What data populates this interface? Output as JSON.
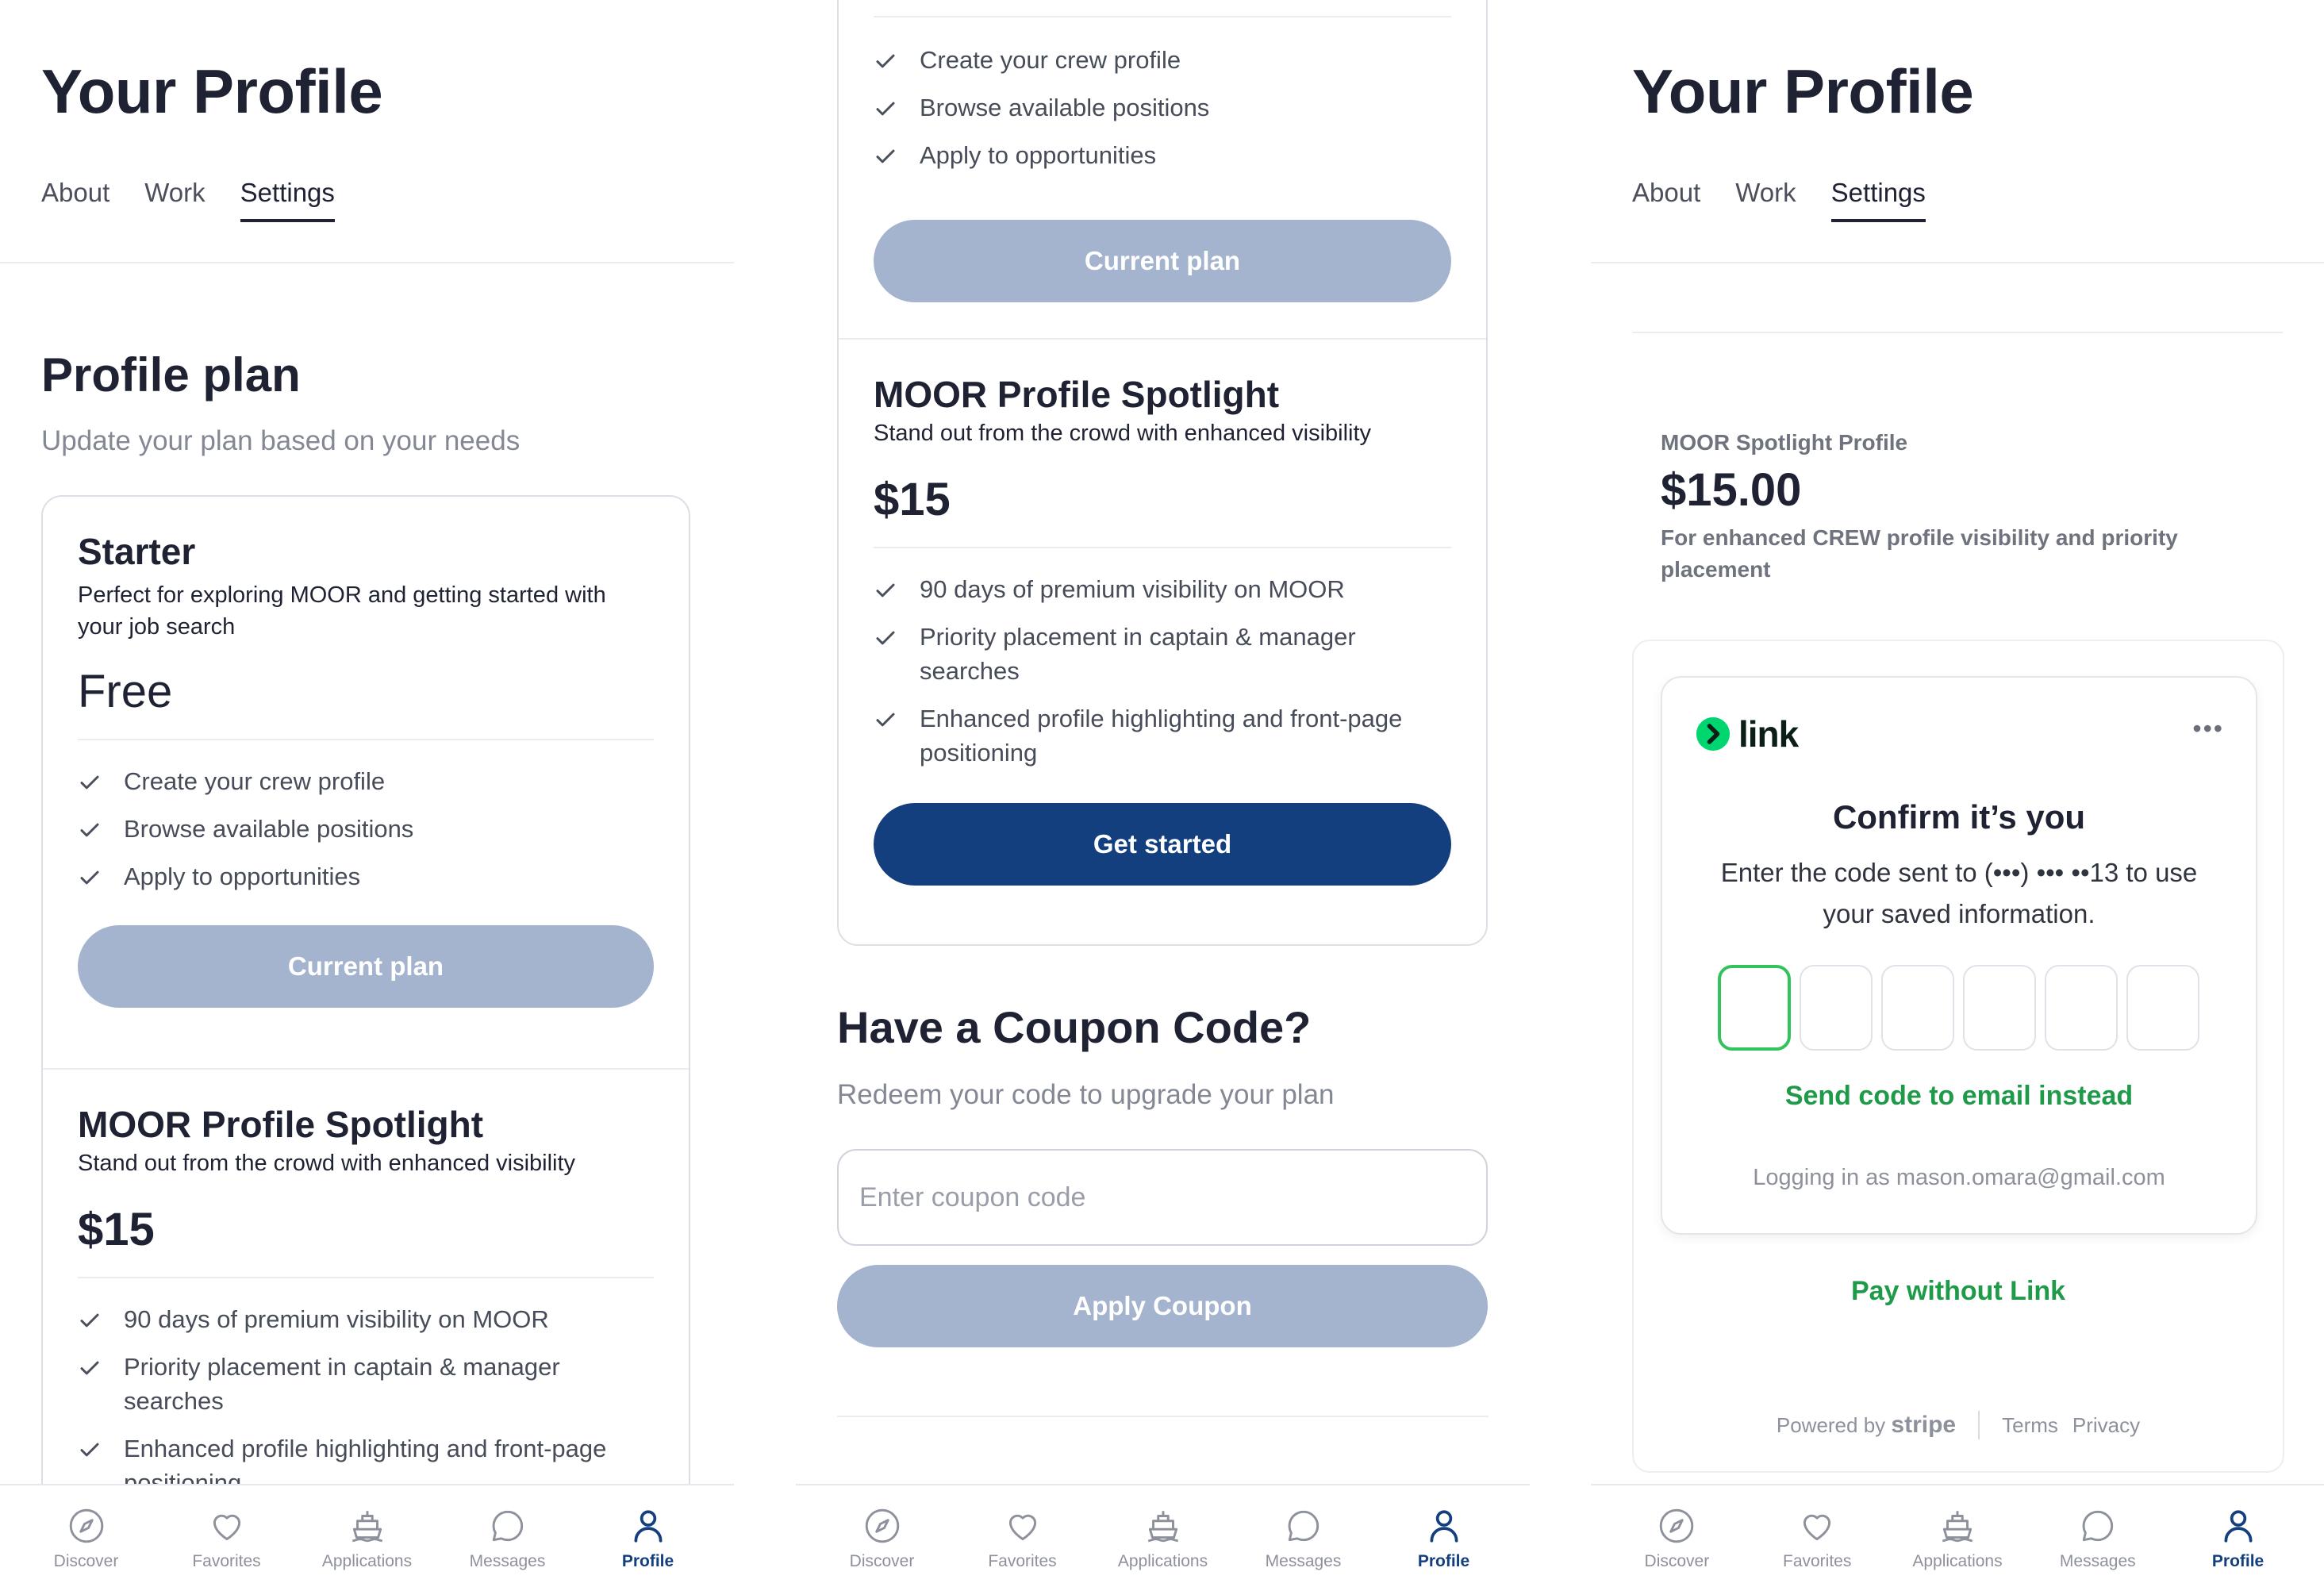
{
  "colors": {
    "primary": "#133f7f",
    "disabled_button": "#a4b4cf",
    "link_green": "#1f9a49",
    "link_green_focus": "#33c35d"
  },
  "profile": {
    "title": "Your Profile",
    "tabs": [
      "About",
      "Work",
      "Settings"
    ],
    "active_tab": "Settings"
  },
  "plan_section": {
    "title": "Profile plan",
    "subtitle": "Update your plan based on your needs"
  },
  "plans": [
    {
      "name": "Starter",
      "description": "Perfect for exploring MOOR and getting started with your job search",
      "price": "Free",
      "features": [
        "Create your crew profile",
        "Browse available positions",
        "Apply to opportunities"
      ],
      "button": "Current plan"
    },
    {
      "name": "MOOR Profile Spotlight",
      "description": "Stand out from the crowd with enhanced visibility",
      "price": "$15",
      "features": [
        "90 days of premium visibility on MOOR",
        "Priority placement in captain & manager searches",
        "Enhanced profile highlighting and front-page positioning"
      ],
      "button": "Get started"
    }
  ],
  "coupon": {
    "title": "Have a Coupon Code?",
    "subtitle": "Redeem your code to upgrade your plan",
    "placeholder": "Enter coupon code",
    "button": "Apply Coupon"
  },
  "checkout": {
    "product": "MOOR Spotlight Profile",
    "amount": "$15.00",
    "description": "For enhanced CREW profile visibility and priority placement",
    "link": {
      "brand": "link",
      "menu_icon": "more-icon",
      "heading": "Confirm it’s you",
      "message": "Enter the code sent to (•••) ••• ••13 to use your saved information.",
      "code_digits": 6,
      "email_link": "Send code to email instead",
      "logged_in_as": "Logging in as mason.omara@gmail.com",
      "pay_without": "Pay without Link"
    },
    "footer": {
      "powered_by": "Powered by",
      "stripe": "stripe",
      "terms": "Terms",
      "privacy": "Privacy"
    }
  },
  "nav": {
    "items": [
      {
        "label": "Discover",
        "icon": "compass-icon"
      },
      {
        "label": "Favorites",
        "icon": "heart-icon"
      },
      {
        "label": "Applications",
        "icon": "boat-icon"
      },
      {
        "label": "Messages",
        "icon": "chat-bubble-icon"
      },
      {
        "label": "Profile",
        "icon": "user-icon"
      }
    ],
    "active": "Profile"
  }
}
